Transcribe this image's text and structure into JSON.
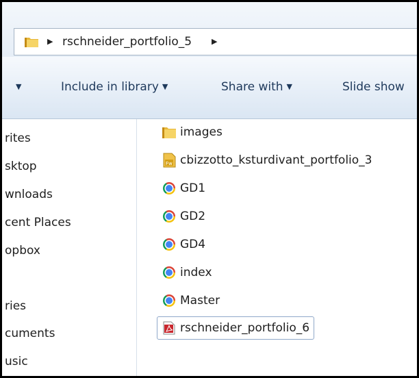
{
  "address": {
    "crumb": "rschneider_portfolio_5"
  },
  "toolbar": {
    "include_label": "Include in library",
    "share_label": "Share with",
    "slideshow_label": "Slide show"
  },
  "nav": {
    "items": [
      "rites",
      "sktop",
      "wnloads",
      "cent Places",
      "opbox",
      "ries",
      "cuments",
      "usic"
    ]
  },
  "files": [
    {
      "name": "images",
      "icon": "folder-icon"
    },
    {
      "name": "cbizzotto_ksturdivant_portfolio_3",
      "icon": "fireworks-icon"
    },
    {
      "name": "GD1",
      "icon": "chrome-icon"
    },
    {
      "name": "GD2",
      "icon": "chrome-icon"
    },
    {
      "name": "GD4",
      "icon": "chrome-icon"
    },
    {
      "name": "index",
      "icon": "chrome-icon"
    },
    {
      "name": "Master",
      "icon": "chrome-icon"
    },
    {
      "name": "rschneider_portfolio_6",
      "icon": "pdf-icon",
      "selected": true
    }
  ],
  "colors": {
    "toolbar_text": "#1e395b",
    "selection_border": "#8fa8c9",
    "frame": "#000000"
  }
}
